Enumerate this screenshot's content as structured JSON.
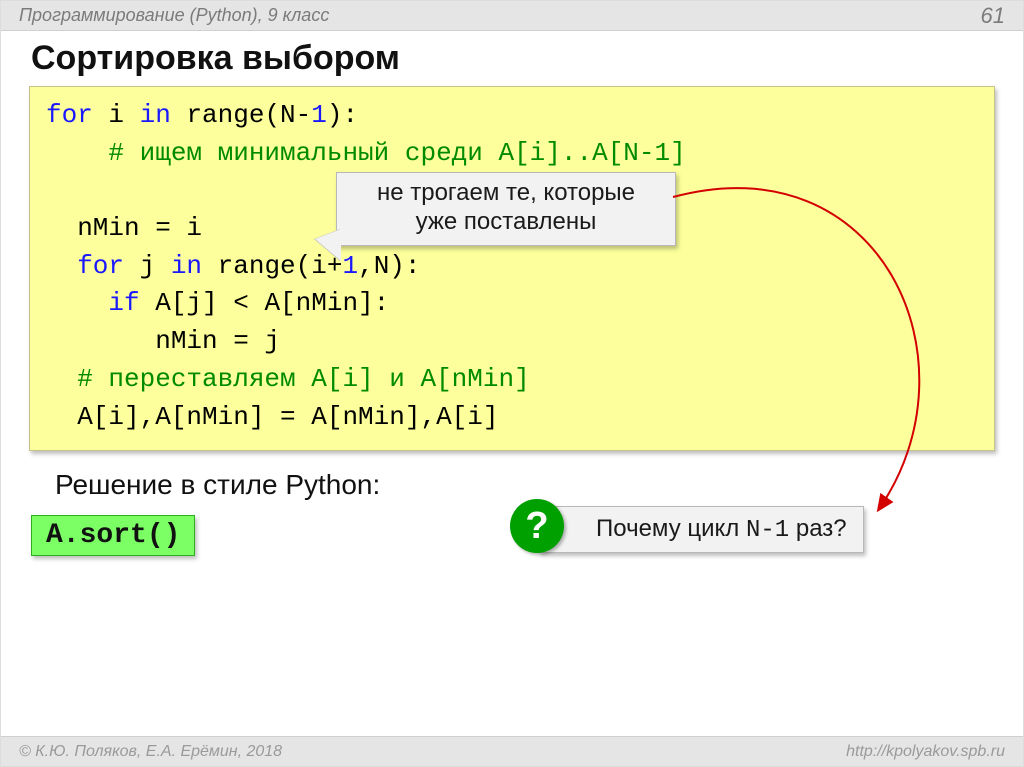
{
  "header": {
    "course": "Программирование (Python), 9 класс",
    "page": "61"
  },
  "title": "Сортировка выбором",
  "code": {
    "l1a": "for",
    "l1b": " i ",
    "l1c": "in",
    "l1d": " range(N-",
    "l1e": "1",
    "l1f": "):",
    "l2": "    # ищем минимальный среди A[i]..A[N-1]",
    "l4": "  nMin = i",
    "l5a": "  for",
    "l5b": " j ",
    "l5c": "in",
    "l5d": " range(i+",
    "l5e": "1",
    "l5f": ",N):",
    "l6a": "    if",
    "l6b": " A[j] < A[nMin]:",
    "l7": "       nMin = j",
    "l8": "  # переставляем A[i] и A[nMin]",
    "l9": "  A[i],A[nMin] = A[nMin],A[i]"
  },
  "callout1": {
    "line1": "не трогаем те, которые",
    "line2": "уже поставлены"
  },
  "question": {
    "pre": "Почему цикл ",
    "mono": "N-1",
    "post": " раз?",
    "badge": "?"
  },
  "py_caption": "Решение в стиле Python:",
  "sort": "A.sort()",
  "footer": {
    "left": "© К.Ю. Поляков, Е.А. Ерёмин, 2018",
    "right": "http://kpolyakov.spb.ru"
  }
}
